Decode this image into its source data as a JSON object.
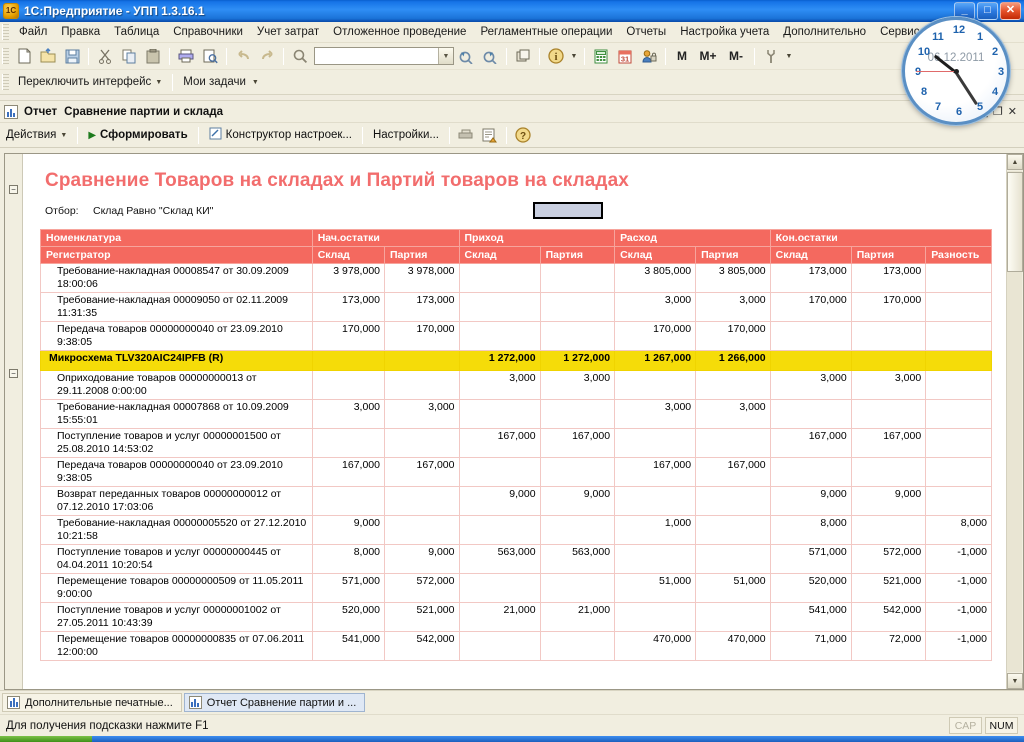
{
  "window": {
    "title": "1С:Предприятие - УПП 1.3.16.1",
    "icon": "1c-logo-icon",
    "minimize": "_",
    "maximize": "□",
    "close": "✕"
  },
  "menubar": {
    "items": [
      {
        "label": "Файл",
        "accel": "Ф"
      },
      {
        "label": "Правка",
        "accel": "П"
      },
      {
        "label": "Таблица",
        "accel": ""
      },
      {
        "label": "Справочники",
        "accel": ""
      },
      {
        "label": "Учет затрат",
        "accel": ""
      },
      {
        "label": "Отложенное проведение",
        "accel": ""
      },
      {
        "label": "Регламентные операции",
        "accel": ""
      },
      {
        "label": "Отчеты",
        "accel": ""
      },
      {
        "label": "Настройка учета",
        "accel": ""
      },
      {
        "label": "Дополнительно",
        "accel": ""
      },
      {
        "label": "Сервис",
        "accel": "С"
      }
    ]
  },
  "toolbar": {
    "icons": [
      {
        "name": "new-document-icon",
        "glyph": "🗋"
      },
      {
        "name": "open-folder-icon",
        "glyph": "📤"
      },
      {
        "name": "save-icon",
        "glyph": "💾"
      },
      {
        "name": "cut-icon",
        "glyph": "✄"
      },
      {
        "name": "copy-icon",
        "glyph": "⧉"
      },
      {
        "name": "paste-icon",
        "glyph": "📋"
      },
      {
        "name": "print-icon",
        "glyph": "🖶"
      },
      {
        "name": "print-preview-icon",
        "glyph": "🔍"
      },
      {
        "name": "undo-icon",
        "glyph": "↩"
      },
      {
        "name": "redo-icon",
        "glyph": "↪"
      },
      {
        "name": "find-icon",
        "glyph": "🔍"
      }
    ],
    "search_value": "",
    "right_icons": [
      {
        "name": "refresh-forward-icon",
        "glyph": "⟳"
      },
      {
        "name": "refresh-back-icon",
        "glyph": "⟲"
      },
      {
        "name": "windows-cascade-icon",
        "glyph": "❐"
      },
      {
        "name": "info-icon",
        "glyph": "ⓘ"
      },
      {
        "name": "calculator-icon",
        "glyph": "▦"
      },
      {
        "name": "calendar-icon",
        "glyph": "31"
      },
      {
        "name": "user-lock-icon",
        "glyph": "👤"
      },
      {
        "name": "memory-m-icon",
        "glyph": "M"
      },
      {
        "name": "memory-m-plus-icon",
        "glyph": "M+"
      },
      {
        "name": "memory-m-minus-icon",
        "glyph": "M-"
      },
      {
        "name": "settings-wrench-icon",
        "glyph": "⚒"
      }
    ]
  },
  "toolbar2": {
    "switch_interface": "Переключить интерфейс",
    "my_tasks": "Мои задачи"
  },
  "clock": {
    "date": "06.12.2011",
    "numbers": [
      "12",
      "1",
      "2",
      "3",
      "4",
      "5",
      "6",
      "7",
      "8",
      "9",
      "10",
      "11"
    ]
  },
  "child_window": {
    "title_prefix": "Отчет",
    "title": "Сравнение партии и склада",
    "minimize": "_",
    "restore": "❐",
    "close": "✕",
    "toolbar": {
      "actions": "Действия",
      "generate": "Сформировать",
      "constructor": "Конструктор настроек...",
      "settings": "Настройки...",
      "icon_print": "print-gray-icon",
      "icon_export": "export-icon",
      "icon_help": "help-icon"
    }
  },
  "report": {
    "title": "Сравнение Товаров на складах и Партий товаров на складах",
    "filter_label": "Отбор:",
    "filter_value": "Склад Равно \"Склад КИ\"",
    "selected_cell": ""
  },
  "table": {
    "header_row1": [
      "Номенклатура",
      "Нач.остатки",
      "",
      "Приход",
      "",
      "Расход",
      "",
      "Кон.остатки",
      "",
      ""
    ],
    "header_row2": [
      "Регистратор",
      "Склад",
      "Партия",
      "Склад",
      "Партия",
      "Склад",
      "Партия",
      "Склад",
      "Партия",
      "Разность"
    ],
    "rows": [
      {
        "type": "data",
        "name": "Требование-накладная 00008547 от 30.09.2009 18:00:06",
        "cells": [
          "3 978,000",
          "3 978,000",
          "",
          "",
          "3 805,000",
          "3 805,000",
          "173,000",
          "173,000",
          ""
        ]
      },
      {
        "type": "data",
        "name": "Требование-накладная 00009050 от 02.11.2009 11:31:35",
        "cells": [
          "173,000",
          "173,000",
          "",
          "",
          "3,000",
          "3,000",
          "170,000",
          "170,000",
          ""
        ]
      },
      {
        "type": "data",
        "name": "Передача товаров 00000000040 от 23.09.2010 9:38:05",
        "cells": [
          "170,000",
          "170,000",
          "",
          "",
          "170,000",
          "170,000",
          "",
          "",
          ""
        ]
      },
      {
        "type": "group",
        "name": "Микросхема TLV320AIC24IPFB (R)",
        "cells": [
          "",
          "",
          "1 272,000",
          "1 272,000",
          "1 267,000",
          "1 266,000",
          "",
          "",
          ""
        ]
      },
      {
        "type": "data",
        "name": "Оприходование товаров 00000000013 от 29.11.2008 0:00:00",
        "cells": [
          "",
          "",
          "3,000",
          "3,000",
          "",
          "",
          "3,000",
          "3,000",
          ""
        ]
      },
      {
        "type": "data",
        "name": "Требование-накладная 00007868 от 10.09.2009 15:55:01",
        "cells": [
          "3,000",
          "3,000",
          "",
          "",
          "3,000",
          "3,000",
          "",
          "",
          ""
        ]
      },
      {
        "type": "data",
        "name": "Поступление товаров и услуг 00000001500 от 25.08.2010 14:53:02",
        "cells": [
          "",
          "",
          "167,000",
          "167,000",
          "",
          "",
          "167,000",
          "167,000",
          ""
        ]
      },
      {
        "type": "data",
        "name": "Передача товаров 00000000040 от 23.09.2010 9:38:05",
        "cells": [
          "167,000",
          "167,000",
          "",
          "",
          "167,000",
          "167,000",
          "",
          "",
          ""
        ]
      },
      {
        "type": "data",
        "name": "Возврат переданных товаров 00000000012 от 07.12.2010 17:03:06",
        "cells": [
          "",
          "",
          "9,000",
          "9,000",
          "",
          "",
          "9,000",
          "9,000",
          ""
        ]
      },
      {
        "type": "data",
        "name": "Требование-накладная 00000005520 от 27.12.2010 10:21:58",
        "cells": [
          "9,000",
          "",
          "",
          "",
          "1,000",
          "",
          "8,000",
          "",
          "8,000"
        ]
      },
      {
        "type": "data",
        "name": "Поступление товаров и услуг 00000000445 от 04.04.2011 10:20:54",
        "cells": [
          "8,000",
          "9,000",
          "563,000",
          "563,000",
          "",
          "",
          "571,000",
          "572,000",
          "-1,000"
        ]
      },
      {
        "type": "data",
        "name": "Перемещение товаров 00000000509 от 11.05.2011 9:00:00",
        "cells": [
          "571,000",
          "572,000",
          "",
          "",
          "51,000",
          "51,000",
          "520,000",
          "521,000",
          "-1,000"
        ]
      },
      {
        "type": "data",
        "name": "Поступление товаров и услуг 00000001002 от 27.05.2011 10:43:39",
        "cells": [
          "520,000",
          "521,000",
          "21,000",
          "21,000",
          "",
          "",
          "541,000",
          "542,000",
          "-1,000"
        ]
      },
      {
        "type": "data",
        "name": "Перемещение товаров 00000000835 от 07.06.2011 12:00:00",
        "cells": [
          "541,000",
          "542,000",
          "",
          "",
          "470,000",
          "470,000",
          "71,000",
          "72,000",
          "-1,000"
        ]
      }
    ]
  },
  "taskbar": {
    "buttons": [
      {
        "label": "Дополнительные печатные...",
        "active": false,
        "icon": "window-icon"
      },
      {
        "label": "Отчет  Сравнение партии и ...",
        "active": true,
        "icon": "report-icon"
      }
    ]
  },
  "statusbar": {
    "hint": "Для получения подсказки нажмите F1",
    "cells": [
      {
        "label": "CAP",
        "dim": true
      },
      {
        "label": "NUM",
        "dim": false
      }
    ]
  },
  "colors": {
    "title_red": "#f26d6d",
    "header_red": "#f4695f",
    "group_yellow": "#f5dc09",
    "negative_red": "#cc3322",
    "titlebar_blue": "#1573e6"
  }
}
